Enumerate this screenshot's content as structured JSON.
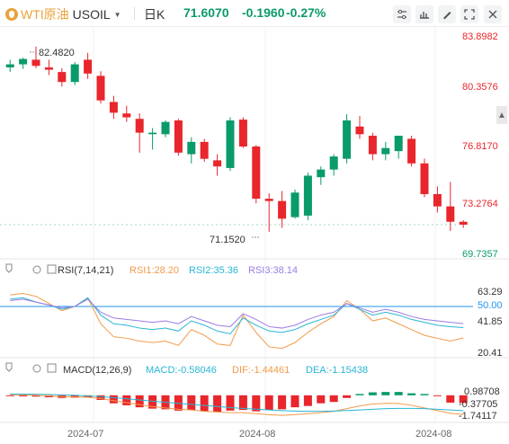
{
  "header": {
    "symbol_name": "WTI原油",
    "symbol_code": "USOIL",
    "period": "日K",
    "last_price": "71.6070",
    "change": "-0.1960",
    "change_pct": "-0.27%"
  },
  "toolbar": {
    "icons": [
      "settings-sliders-icon",
      "scale-icon",
      "drawing-tools-icon",
      "fullscreen-icon",
      "close-icon"
    ]
  },
  "colors": {
    "up": "#0a9b6a",
    "down": "#e8262b",
    "rsi1": "#f29a4a",
    "rsi2": "#28b6d4",
    "rsi3": "#9b7be6",
    "macd": "#28b6d4",
    "dif": "#f29a4a",
    "dea": "#28b6d4",
    "ref_line": "#2196f3"
  },
  "chart_data": [
    {
      "type": "candlestick",
      "title": "USOIL 日K",
      "y_ticks": [
        "83.8982",
        "80.3576",
        "76.8170",
        "73.2764",
        "69.7357"
      ],
      "ylim": [
        69.7357,
        83.8982
      ],
      "x_ticks": [
        "2024-07",
        "2024-08",
        "2024-08"
      ],
      "annotations": {
        "high_label": "82.4820",
        "low_label": "71.1520"
      },
      "candles": [
        {
          "o": 81.85,
          "h": 82.35,
          "l": 81.55,
          "c": 82.05
        },
        {
          "o": 82.05,
          "h": 82.48,
          "l": 81.75,
          "c": 82.4
        },
        {
          "o": 82.35,
          "h": 83.2,
          "l": 81.8,
          "c": 81.95
        },
        {
          "o": 81.85,
          "h": 82.35,
          "l": 81.35,
          "c": 81.7
        },
        {
          "o": 81.55,
          "h": 81.8,
          "l": 80.6,
          "c": 80.9
        },
        {
          "o": 80.9,
          "h": 82.2,
          "l": 80.7,
          "c": 82.05
        },
        {
          "o": 82.35,
          "h": 82.8,
          "l": 81.1,
          "c": 81.45
        },
        {
          "o": 81.3,
          "h": 81.6,
          "l": 79.5,
          "c": 79.7
        },
        {
          "o": 79.6,
          "h": 80.0,
          "l": 78.5,
          "c": 78.9
        },
        {
          "o": 78.85,
          "h": 79.35,
          "l": 78.3,
          "c": 78.6
        },
        {
          "o": 78.5,
          "h": 78.85,
          "l": 76.3,
          "c": 77.6
        },
        {
          "o": 77.5,
          "h": 77.9,
          "l": 76.5,
          "c": 77.6
        },
        {
          "o": 77.5,
          "h": 78.4,
          "l": 77.3,
          "c": 78.3
        },
        {
          "o": 78.4,
          "h": 78.5,
          "l": 76.1,
          "c": 76.3
        },
        {
          "o": 76.2,
          "h": 77.3,
          "l": 75.6,
          "c": 77.0
        },
        {
          "o": 77.0,
          "h": 77.2,
          "l": 75.7,
          "c": 75.9
        },
        {
          "o": 75.8,
          "h": 76.2,
          "l": 74.8,
          "c": 75.4
        },
        {
          "o": 75.3,
          "h": 78.6,
          "l": 75.1,
          "c": 78.4
        },
        {
          "o": 78.45,
          "h": 78.6,
          "l": 76.6,
          "c": 76.7
        },
        {
          "o": 76.7,
          "h": 76.8,
          "l": 73.0,
          "c": 73.3
        },
        {
          "o": 73.3,
          "h": 73.65,
          "l": 71.15,
          "c": 73.15
        },
        {
          "o": 73.15,
          "h": 73.8,
          "l": 71.4,
          "c": 72.0
        },
        {
          "o": 72.1,
          "h": 73.9,
          "l": 72.0,
          "c": 73.7
        },
        {
          "o": 72.2,
          "h": 75.0,
          "l": 71.9,
          "c": 74.8
        },
        {
          "o": 74.7,
          "h": 75.4,
          "l": 74.2,
          "c": 75.2
        },
        {
          "o": 75.2,
          "h": 76.2,
          "l": 74.8,
          "c": 76.05
        },
        {
          "o": 75.9,
          "h": 78.8,
          "l": 75.6,
          "c": 78.4
        },
        {
          "o": 78.0,
          "h": 78.7,
          "l": 77.2,
          "c": 77.5
        },
        {
          "o": 77.4,
          "h": 77.6,
          "l": 75.8,
          "c": 76.2
        },
        {
          "o": 76.2,
          "h": 77.0,
          "l": 75.8,
          "c": 76.6
        },
        {
          "o": 76.4,
          "h": 77.4,
          "l": 75.9,
          "c": 77.4
        },
        {
          "o": 77.2,
          "h": 77.4,
          "l": 75.4,
          "c": 75.6
        },
        {
          "o": 75.6,
          "h": 75.9,
          "l": 73.4,
          "c": 73.6
        },
        {
          "o": 73.6,
          "h": 74.1,
          "l": 72.4,
          "c": 72.8
        },
        {
          "o": 72.8,
          "h": 74.4,
          "l": 71.2,
          "c": 71.8
        },
        {
          "o": 71.8,
          "h": 71.9,
          "l": 71.4,
          "c": 71.61
        }
      ]
    },
    {
      "type": "line",
      "title": "RSI(7,14,21)",
      "legend": [
        {
          "label": "RSI1:28.20",
          "color": "#f29a4a"
        },
        {
          "label": "RSI2:35.36",
          "color": "#28b6d4"
        },
        {
          "label": "RSI3:38.14",
          "color": "#9b7be6"
        }
      ],
      "y_ticks": [
        "63.29",
        "50.00",
        "41.85",
        "20.41"
      ],
      "ylim": [
        17,
        68
      ],
      "ref_line": 50,
      "series": [
        {
          "name": "RSI1",
          "values": [
            58,
            59,
            57,
            52,
            47,
            50,
            56,
            38,
            29,
            28,
            26,
            25,
            26,
            23,
            34,
            30,
            24,
            23,
            44,
            32,
            22,
            21,
            25,
            32,
            38,
            43,
            54,
            48,
            40,
            42,
            38,
            34,
            30,
            28,
            26,
            28.2
          ]
        },
        {
          "name": "RSI2",
          "values": [
            55,
            56,
            53,
            51,
            48,
            50,
            56,
            44,
            38,
            37,
            35,
            34,
            35,
            33,
            40,
            37,
            33,
            31,
            42,
            37,
            33,
            32,
            34,
            38,
            41,
            44,
            52,
            48,
            44,
            46,
            44,
            41,
            39,
            37,
            36,
            35.36
          ]
        },
        {
          "name": "RSI3",
          "values": [
            54,
            55,
            53,
            51,
            49,
            50,
            55,
            46,
            42,
            41,
            40,
            39,
            40,
            38,
            43,
            40,
            37,
            36,
            45,
            41,
            36,
            35,
            37,
            41,
            44,
            46,
            52,
            49,
            46,
            48,
            46,
            43,
            41,
            40,
            39,
            38.14
          ]
        }
      ]
    },
    {
      "type": "bar",
      "title": "MACD(12,26,9)",
      "legend": [
        {
          "label": "MACD:-0.58046",
          "color": "#28b6d4"
        },
        {
          "label": "DIF:-1.44461",
          "color": "#f29a4a"
        },
        {
          "label": "DEA:-1.15438",
          "color": "#28b6d4"
        }
      ],
      "y_ticks": [
        "0.98708",
        "-0.37705",
        "-1.74117"
      ],
      "ylim": [
        -1.9,
        1.2
      ],
      "macd": [
        -0.05,
        -0.08,
        -0.1,
        -0.15,
        -0.2,
        -0.18,
        -0.15,
        -0.35,
        -0.6,
        -0.75,
        -0.9,
        -1.0,
        -1.05,
        -1.15,
        -1.1,
        -1.2,
        -1.25,
        -1.15,
        -1.1,
        -1.2,
        -1.1,
        -1.05,
        -0.9,
        -0.8,
        -0.6,
        -0.5,
        -0.2,
        0.1,
        0.22,
        0.25,
        0.25,
        0.15,
        0.1,
        -0.05,
        -0.55,
        -0.58046
      ],
      "dif": [
        0.05,
        0.03,
        0.0,
        -0.05,
        -0.1,
        -0.12,
        -0.15,
        -0.25,
        -0.4,
        -0.55,
        -0.7,
        -0.85,
        -0.95,
        -1.05,
        -1.1,
        -1.2,
        -1.25,
        -1.3,
        -1.3,
        -1.38,
        -1.45,
        -1.5,
        -1.45,
        -1.38,
        -1.3,
        -1.2,
        -1.0,
        -0.8,
        -0.65,
        -0.6,
        -0.62,
        -0.75,
        -0.95,
        -1.15,
        -1.35,
        -1.44461
      ],
      "dea": [
        0.1,
        0.09,
        0.08,
        0.06,
        0.03,
        0.0,
        -0.05,
        -0.1,
        -0.18,
        -0.26,
        -0.35,
        -0.44,
        -0.52,
        -0.6,
        -0.68,
        -0.76,
        -0.84,
        -0.92,
        -0.98,
        -1.04,
        -1.1,
        -1.15,
        -1.18,
        -1.2,
        -1.2,
        -1.18,
        -1.14,
        -1.1,
        -1.05,
        -1.0,
        -0.98,
        -0.98,
        -1.0,
        -1.05,
        -1.1,
        -1.15438
      ]
    }
  ]
}
